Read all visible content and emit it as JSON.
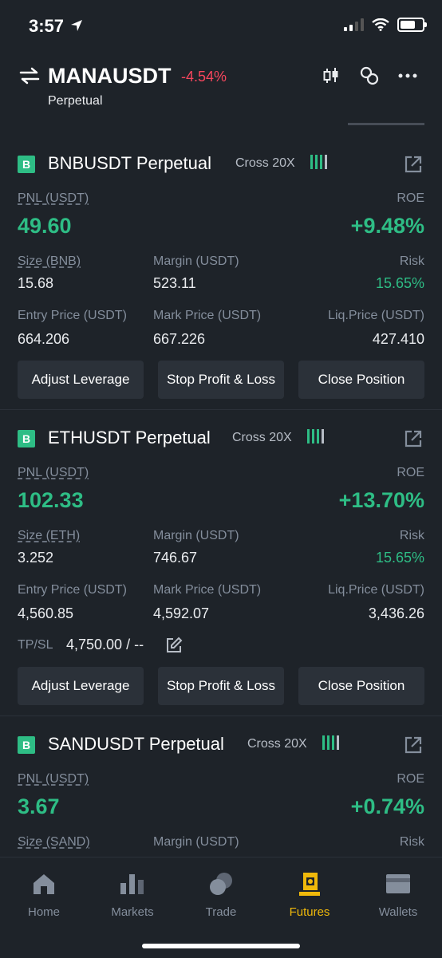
{
  "status": {
    "time": "3:57"
  },
  "header": {
    "symbol": "MANAUSDT",
    "change": "-4.54%",
    "contract_type": "Perpetual"
  },
  "positions": [
    {
      "pair": "BNBUSDT Perpetual",
      "cross": "Cross 20X",
      "pnl_label": "PNL (USDT)",
      "pnl": "49.60",
      "roe_label": "ROE",
      "roe": "+9.48%",
      "size_label": "Size (BNB)",
      "size": "15.68",
      "margin_label": "Margin (USDT)",
      "margin": "523.11",
      "risk_label": "Risk",
      "risk": "15.65%",
      "entry_label": "Entry Price (USDT)",
      "entry": "664.206",
      "mark_label": "Mark Price (USDT)",
      "mark": "667.226",
      "liq_label": "Liq.Price (USDT)",
      "liq": "427.410",
      "btn_leverage": "Adjust Leverage",
      "btn_tpsl": "Stop Profit & Loss",
      "btn_close": "Close Position"
    },
    {
      "pair": "ETHUSDT Perpetual",
      "cross": "Cross 20X",
      "pnl_label": "PNL (USDT)",
      "pnl": "102.33",
      "roe_label": "ROE",
      "roe": "+13.70%",
      "size_label": "Size (ETH)",
      "size": "3.252",
      "margin_label": "Margin (USDT)",
      "margin": "746.67",
      "risk_label": "Risk",
      "risk": "15.65%",
      "entry_label": "Entry Price (USDT)",
      "entry": "4,560.85",
      "mark_label": "Mark Price (USDT)",
      "mark": "4,592.07",
      "liq_label": "Liq.Price (USDT)",
      "liq": "3,436.26",
      "tpsl_label": "TP/SL",
      "tpsl_value": "4,750.00 / --",
      "btn_leverage": "Adjust Leverage",
      "btn_tpsl": "Stop Profit & Loss",
      "btn_close": "Close Position"
    },
    {
      "pair": "SANDUSDT Perpetual",
      "cross": "Cross 20X",
      "pnl_label": "PNL (USDT)",
      "pnl": "3.67",
      "roe_label": "ROE",
      "roe": "+0.74%",
      "size_label": "Size (SAND)",
      "margin_label": "Margin (USDT)",
      "risk_label": "Risk"
    }
  ],
  "tabbar": {
    "items": [
      {
        "label": "Home",
        "icon": "home-icon"
      },
      {
        "label": "Markets",
        "icon": "markets-icon"
      },
      {
        "label": "Trade",
        "icon": "trade-icon"
      },
      {
        "label": "Futures",
        "icon": "futures-icon",
        "active": true
      },
      {
        "label": "Wallets",
        "icon": "wallet-icon"
      }
    ]
  },
  "colors": {
    "background": "#1e2329",
    "positive": "#2ebd85",
    "negative": "#f6465d",
    "accent": "#f0b90b",
    "button": "#2b3139"
  }
}
